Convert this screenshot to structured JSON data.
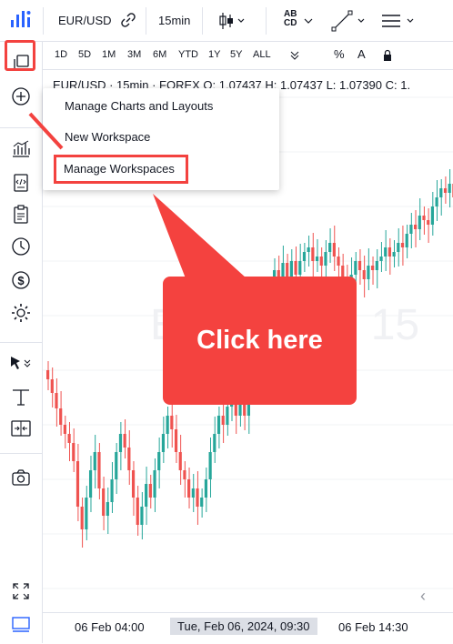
{
  "topbar": {
    "symbol": "EUR/USD",
    "interval": "15min",
    "abcd_label_top": "AB",
    "abcd_label_bottom": "CD"
  },
  "ranges": [
    "1D",
    "5D",
    "1M",
    "3M",
    "6M",
    "YTD",
    "1Y",
    "5Y",
    "ALL"
  ],
  "ranges_extra": {
    "percent": "%",
    "auto": "A"
  },
  "legend": {
    "text": "EUR/USD · 15min · FOREX   O: 1.07437  H: 1.07437  L: 1.07390  C: 1."
  },
  "watermark": "EUR/USD, 15",
  "dropdown": {
    "items": [
      "Manage Charts and Layouts",
      "New Workspace",
      "Manage Workspaces"
    ]
  },
  "callout": {
    "text": "Click here"
  },
  "timeaxis": {
    "left": "06 Feb 04:00",
    "crosshair": "Tue, Feb 06, 2024, 09:30",
    "right": "06 Feb 14:30"
  },
  "colors": {
    "up": "#26a69a",
    "down": "#ef5350",
    "highlight": "#f3423f"
  },
  "icons": {
    "leftbar": [
      "copy-icon",
      "plus-circle-icon",
      "bar-chart-icon",
      "script-icon",
      "clipboard-icon",
      "clock-icon",
      "dollar-icon",
      "gear-icon",
      "cursor-icon",
      "crosshair-icon",
      "compare-icon",
      "camera-icon",
      "fullscreen-icon",
      "monitor-icon"
    ]
  }
}
